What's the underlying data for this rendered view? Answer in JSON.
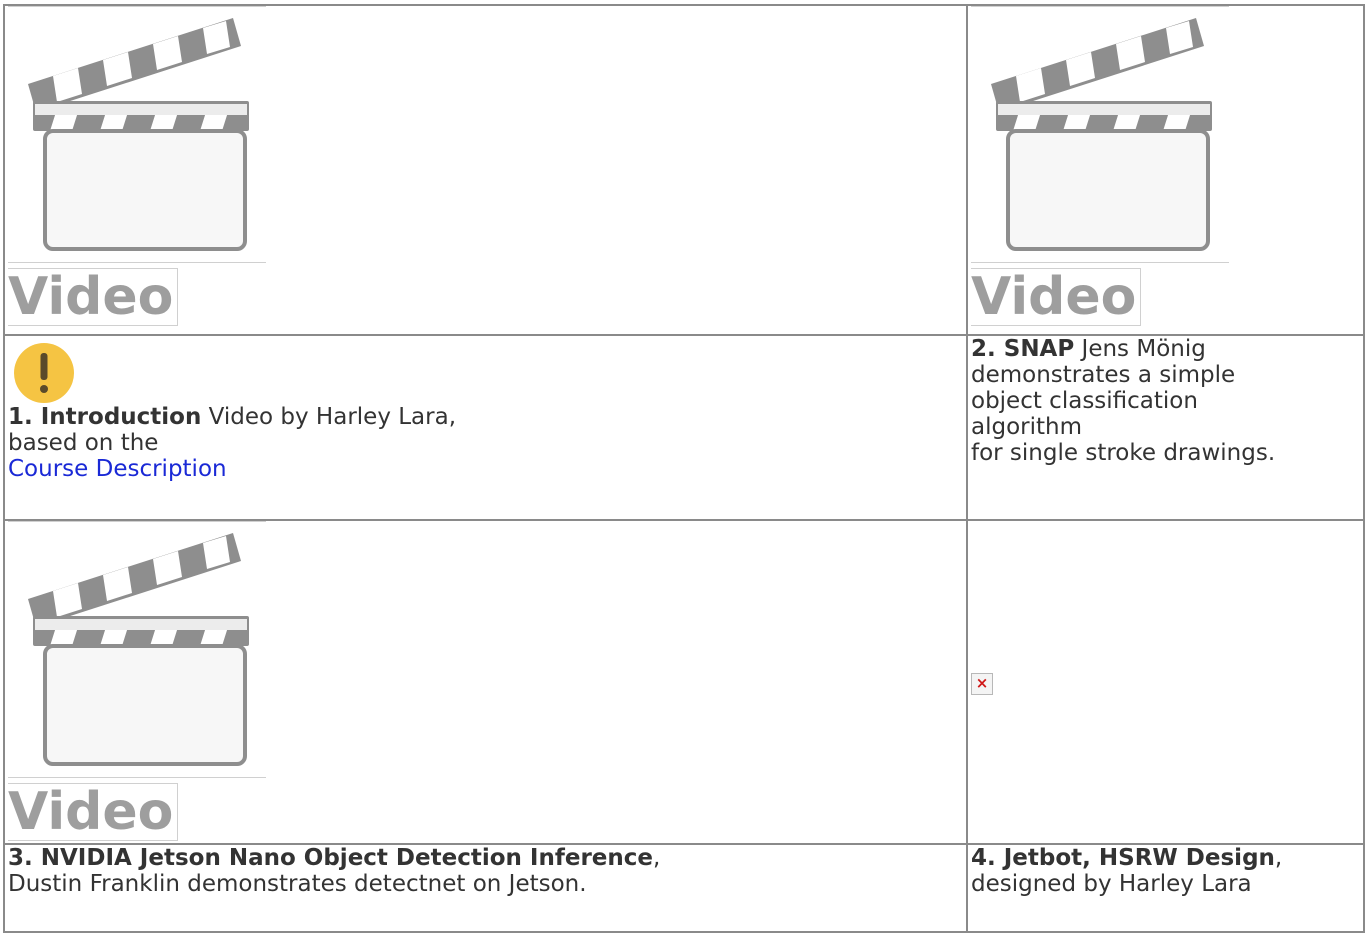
{
  "video_placeholders": [
    {
      "label": "Video"
    },
    {
      "label": "Video"
    },
    {
      "label": "Video"
    }
  ],
  "cells": {
    "intro": {
      "number_title": "1. Introduction",
      "text_1": " Video by Harley Lara,",
      "text_2": "based on the",
      "link": "Course Description"
    },
    "snap": {
      "number_title": "2. SNAP",
      "text_1": " Jens Mönig",
      "text_2": "demonstrates a simple",
      "text_3": "object classification",
      "text_4": "algorithm",
      "text_5": "for single stroke drawings."
    },
    "nvidia": {
      "number_title": "3. NVIDIA Jetson Nano Object Detection Inference",
      "suffix": ",",
      "text_1": "Dustin Franklin demonstrates detectnet on Jetson."
    },
    "jetbot": {
      "number_title": "4. Jetbot, HSRW Design",
      "suffix": ",",
      "text_1": "designed by Harley Lara"
    }
  },
  "icons": {
    "warning": "warning-icon",
    "clapperboard": "clapperboard-icon",
    "broken_image": "broken-image-icon"
  },
  "colors": {
    "warning_yellow": "#f5c443",
    "link_blue": "#1a29d6",
    "video_label_gray": "#9e9e9e",
    "border_gray": "#8a8a8a"
  }
}
